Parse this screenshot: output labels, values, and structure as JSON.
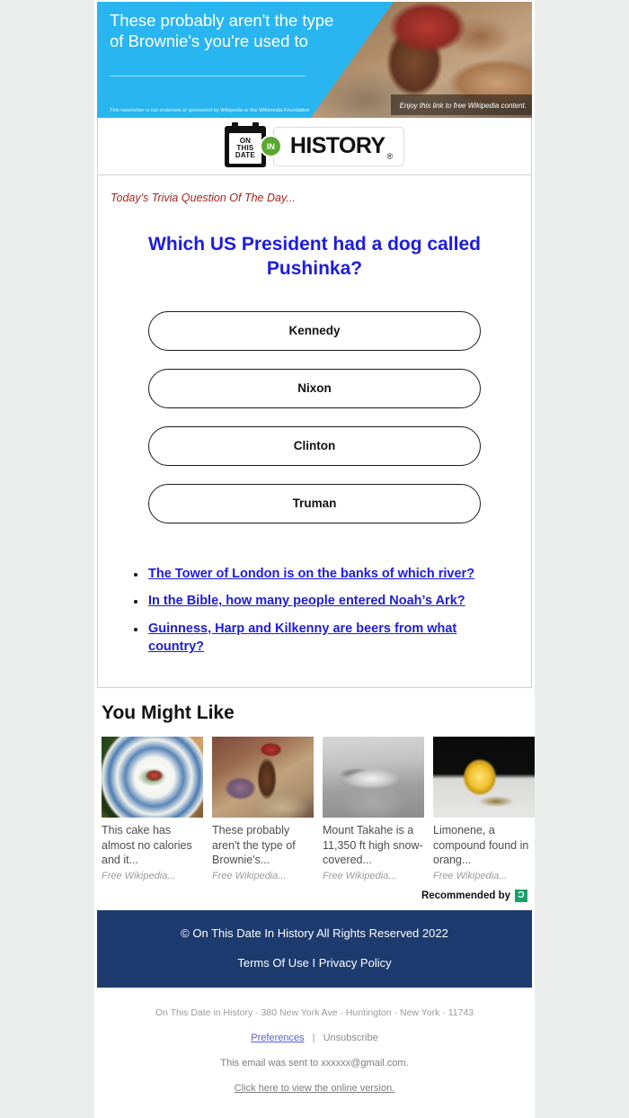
{
  "ad": {
    "headline": "These probably aren't the type of Brownie's you're used to",
    "disclaimer": "This newsletter is not endorsed or sponsored by Wikipedia or the Wikimedia Foundation",
    "caption": "Enjoy this link to free Wikipedia content.",
    "accent_color": "#29b6f0"
  },
  "logo": {
    "calendar_line1": "ON",
    "calendar_line2": "THIS",
    "calendar_line3": "DATE",
    "in_badge": "IN",
    "wordmark": "HISTORY",
    "registered": "®",
    "badge_color": "#5aa832"
  },
  "trivia": {
    "kicker": "Today's Trivia Question Of The Day...",
    "question": "Which US President had a dog called Pushinka?",
    "question_color": "#1c1ce0",
    "answers": [
      {
        "label": "Kennedy"
      },
      {
        "label": "Nixon"
      },
      {
        "label": "Clinton"
      },
      {
        "label": "Truman"
      }
    ],
    "more_links": [
      {
        "label": "The Tower of London is on the banks of which river?"
      },
      {
        "label": "In the Bible, how many people entered Noah’s Ark?"
      },
      {
        "label": "Guinness, Harp and Kilkenny are beers from what country?"
      }
    ]
  },
  "recommendations": {
    "title": "You Might Like",
    "cards": [
      {
        "title": "This cake has almost no calories and it...",
        "source": "Free Wikipedia..."
      },
      {
        "title": "These probably aren't the type of Brownie's...",
        "source": "Free Wikipedia..."
      },
      {
        "title": "Mount Takahe is a 11,350 ft high snow-covered...",
        "source": "Free Wikipedia..."
      },
      {
        "title": "Limonene, a compound found in orang...",
        "source": "Free Wikipedia..."
      }
    ],
    "recommended_by": "Recommended by",
    "provider_badge": "Ɔ"
  },
  "footer": {
    "copyright": "© On This Date In History All Rights Reserved 2022",
    "terms_label": "Terms Of Use",
    "separator": "I",
    "privacy_label": "Privacy Policy",
    "background_color": "#1d3b6e"
  },
  "legal": {
    "address": "On This Date in History · 380 New York Ave · Huntington · New York · 11743",
    "preferences_label": "Preferences",
    "separator": "|",
    "unsubscribe_label": "Unsubscribe",
    "sent_to": "This email was sent to xxxxxx@gmail.com.",
    "online_version": "Click here to view the online version."
  }
}
